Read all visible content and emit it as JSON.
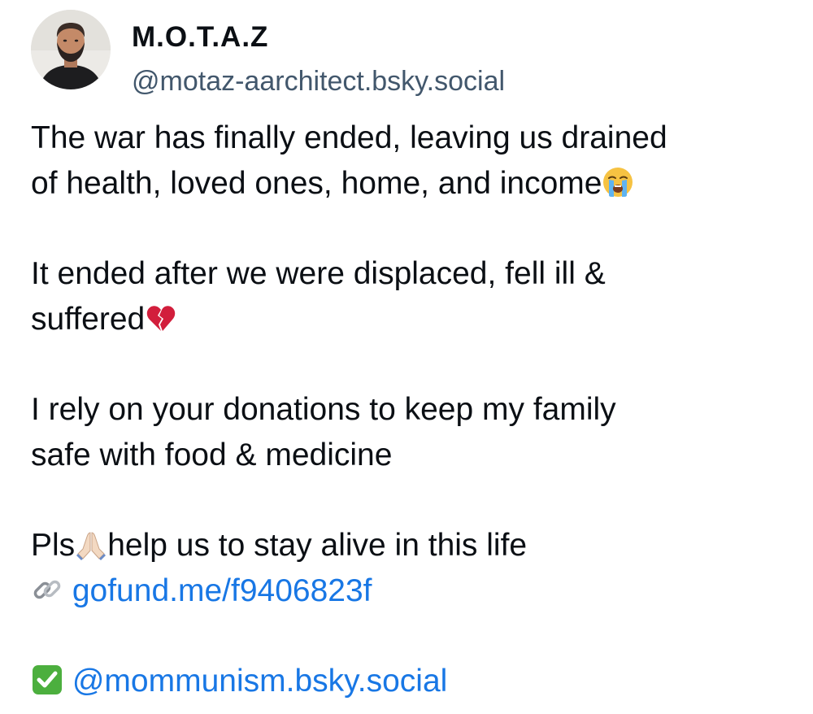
{
  "author": {
    "display_name": "M.O.T.A.Z",
    "handle": "@motaz-aarchitect.bsky.social"
  },
  "post": {
    "p1_line1": "The war has finally ended, leaving us drained",
    "p1_line2": "of health, loved ones, home, and income",
    "p1_emoji": "loudly-crying-face-icon",
    "p2_line1": "It ended after we were displaced, fell ill &",
    "p2_line2": "suffered",
    "p2_emoji": "broken-heart-icon",
    "p3_line1": "I rely on your donations to keep my family",
    "p3_line2": "safe with food & medicine",
    "p4_line1_start": "Pls",
    "p4_line1_emoji": "folded-hands-icon",
    "p4_line1_end": "help us to stay alive in this life",
    "p4_link_icon": "link-icon",
    "p4_link_text": "gofund.me/f9406823f",
    "p5_check_icon": "check-mark-button-icon",
    "p5_mention": "@mommunism.bsky.social"
  },
  "colors": {
    "text": "#0b0f14",
    "handle": "#42576c",
    "link": "#1877e5"
  }
}
